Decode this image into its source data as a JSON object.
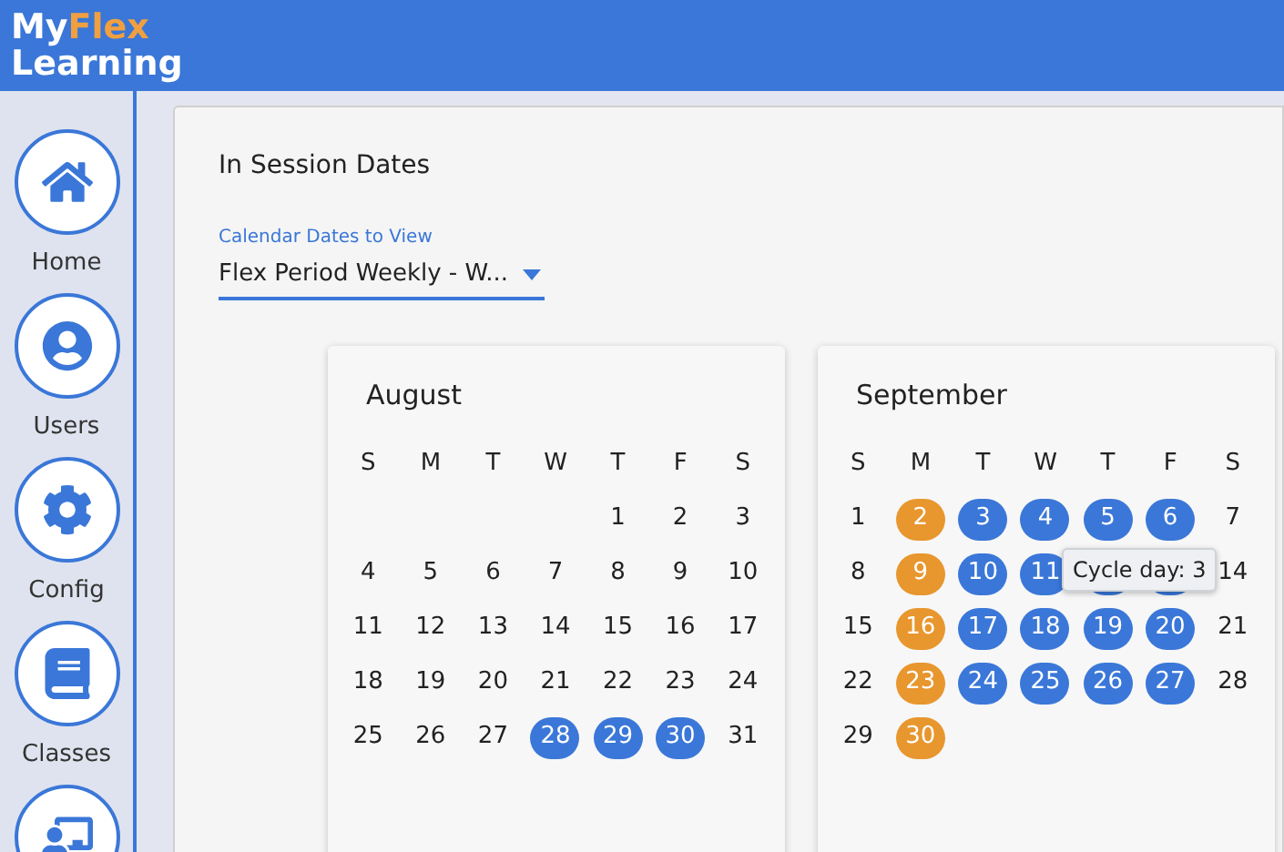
{
  "logo": {
    "part1": "My",
    "part2": "Flex",
    "part3": "Learning"
  },
  "sidebar": {
    "items": [
      {
        "kind": "home",
        "label": "Home"
      },
      {
        "kind": "users",
        "label": "Users"
      },
      {
        "kind": "config",
        "label": "Config"
      },
      {
        "kind": "classes",
        "label": "Classes"
      },
      {
        "kind": "teacher"
      }
    ]
  },
  "panel": {
    "title": "In Session Dates",
    "select": {
      "label": "Calendar Dates to View",
      "value": "Flex Period Weekly - W..."
    }
  },
  "months": [
    {
      "name": "August",
      "weekdays": [
        "S",
        "M",
        "T",
        "W",
        "T",
        "F",
        "S"
      ],
      "weeks": [
        [
          {
            "kind": "blank"
          },
          {
            "kind": "blank"
          },
          {
            "kind": "blank"
          },
          {
            "kind": "blank"
          },
          {
            "label": "1"
          },
          {
            "label": "2"
          },
          {
            "label": "3"
          }
        ],
        [
          {
            "label": "4"
          },
          {
            "label": "5"
          },
          {
            "label": "6"
          },
          {
            "label": "7"
          },
          {
            "label": "8"
          },
          {
            "label": "9"
          },
          {
            "label": "10"
          }
        ],
        [
          {
            "label": "11"
          },
          {
            "label": "12"
          },
          {
            "label": "13"
          },
          {
            "label": "14"
          },
          {
            "label": "15"
          },
          {
            "label": "16"
          },
          {
            "label": "17"
          }
        ],
        [
          {
            "label": "18"
          },
          {
            "label": "19"
          },
          {
            "label": "20"
          },
          {
            "label": "21"
          },
          {
            "label": "22"
          },
          {
            "label": "23"
          },
          {
            "label": "24"
          }
        ],
        [
          {
            "label": "25"
          },
          {
            "label": "26"
          },
          {
            "label": "27"
          },
          {
            "label": "28",
            "color": "#3a77d8"
          },
          {
            "label": "29",
            "color": "#3a77d8"
          },
          {
            "label": "30",
            "color": "#3a77d8"
          },
          {
            "label": "31"
          }
        ]
      ]
    },
    {
      "name": "September",
      "weekdays": [
        "S",
        "M",
        "T",
        "W",
        "T",
        "F",
        "S"
      ],
      "tooltip": "Cycle day: 3",
      "weeks": [
        [
          {
            "label": "1"
          },
          {
            "label": "2",
            "color": "#e8962e"
          },
          {
            "label": "3",
            "color": "#3a77d8"
          },
          {
            "label": "4",
            "color": "#3a77d8"
          },
          {
            "label": "5",
            "color": "#3a77d8"
          },
          {
            "label": "6",
            "color": "#3a77d8"
          },
          {
            "label": "7"
          }
        ],
        [
          {
            "label": "8"
          },
          {
            "label": "9",
            "color": "#e8962e"
          },
          {
            "label": "10",
            "color": "#3a77d8"
          },
          {
            "label": "11",
            "color": "#3a77d8"
          },
          {
            "kind": "covered"
          },
          {
            "kind": "covered"
          },
          {
            "label": "14"
          }
        ],
        [
          {
            "label": "15"
          },
          {
            "label": "16",
            "color": "#e8962e"
          },
          {
            "label": "17",
            "color": "#3a77d8"
          },
          {
            "label": "18",
            "color": "#3a77d8"
          },
          {
            "label": "19",
            "color": "#3a77d8"
          },
          {
            "label": "20",
            "color": "#3a77d8"
          },
          {
            "label": "21"
          }
        ],
        [
          {
            "label": "22"
          },
          {
            "label": "23",
            "color": "#e8962e"
          },
          {
            "label": "24",
            "color": "#3a77d8"
          },
          {
            "label": "25",
            "color": "#3a77d8"
          },
          {
            "label": "26",
            "color": "#3a77d8"
          },
          {
            "label": "27",
            "color": "#3a77d8"
          },
          {
            "label": "28"
          }
        ],
        [
          {
            "label": "29"
          },
          {
            "label": "30",
            "color": "#e8962e"
          },
          {
            "kind": "blank"
          },
          {
            "kind": "blank"
          },
          {
            "kind": "blank"
          },
          {
            "kind": "blank"
          },
          {
            "kind": "blank"
          }
        ]
      ]
    }
  ]
}
